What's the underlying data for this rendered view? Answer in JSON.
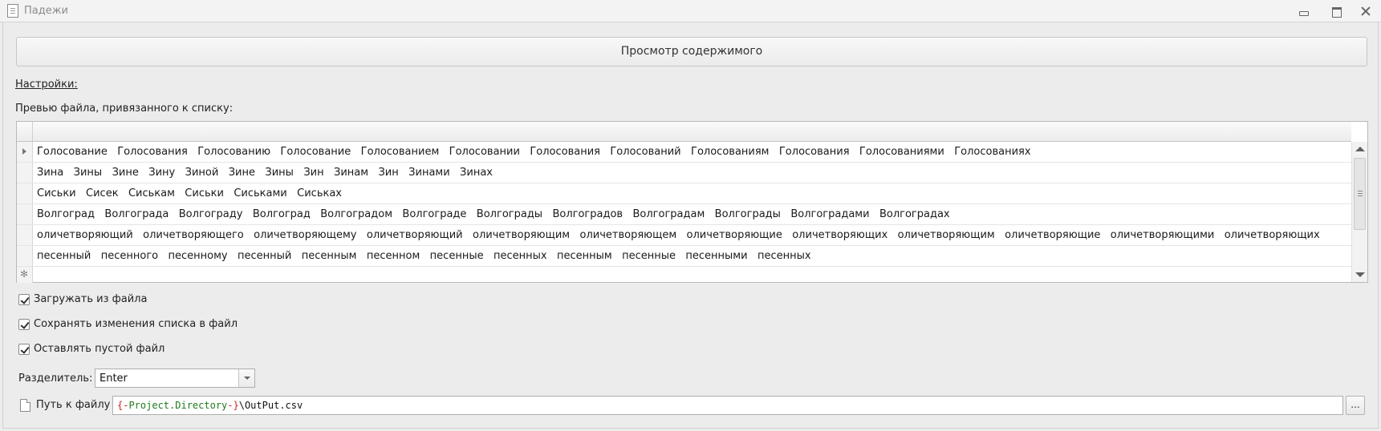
{
  "window": {
    "title": "Падежи"
  },
  "view_button_label": "Просмотр содержимого",
  "settings_label": "Настройки:",
  "preview_label": "Превью файла, привязанного к списку:",
  "grid": {
    "rows": [
      "Голосование   Голосования   Голосованию   Голосование   Голосованием   Голосовании   Голосования   Голосований   Голосованиям   Голосования   Голосованиями   Голосованиях",
      "Зина   Зины   Зине   Зину   Зиной   Зине   Зины   Зин   Зинам   Зин   Зинами   Зинах",
      "Сиськи   Сисек   Сиськам   Сиськи   Сиськами   Сиськах",
      "Волгоград   Волгограда   Волгограду   Волгоград   Волгоградом   Волгограде   Волгограды   Волгоградов   Волгоградам   Волгограды   Волгоградами   Волгоградах",
      "оличетворяющий   оличетворяющего   оличетворяющему   оличетворяющий   оличетворяющим   оличетворяющем   оличетворяющие   оличетворяющих   оличетворяющим   оличетворяющие   оличетворяющими   оличетворяющих",
      "песенный   песенного   песенному   песенный   песенным   песенном   песенные   песенных   песенным   песенные   песенными   песенных"
    ],
    "new_row_marker": "✻"
  },
  "checkboxes": {
    "load_from_file": {
      "label": "Загружать из файла",
      "checked": true
    },
    "save_changes": {
      "label": "Сохранять изменения списка в файл",
      "checked": true
    },
    "keep_empty": {
      "label": "Оставлять пустой файл",
      "checked": true
    }
  },
  "separator": {
    "label": "Разделитель:",
    "value": "Enter"
  },
  "path": {
    "label": "Путь к файлу",
    "brace_open": "{-",
    "variable": "Project.Directory",
    "brace_close": "-}",
    "rest": "\\OutPut.csv",
    "browse_label": "..."
  },
  "colors": {
    "brace": "#d02020",
    "variable": "#1e7a1e"
  }
}
